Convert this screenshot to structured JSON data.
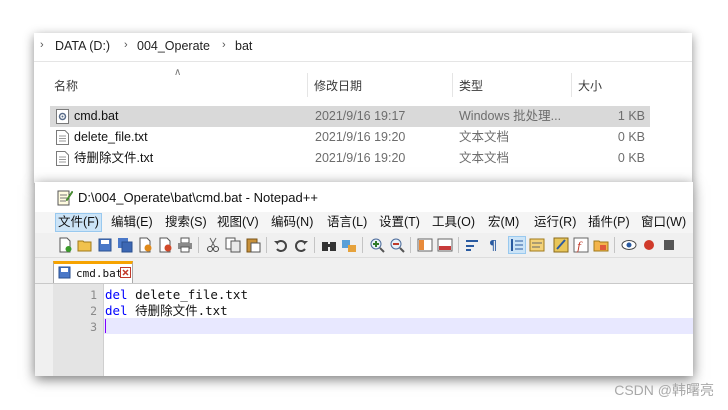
{
  "explorer": {
    "breadcrumb": [
      "DATA (D:)",
      "004_Operate",
      "bat"
    ],
    "columns": [
      "名称",
      "修改日期",
      "类型",
      "大小"
    ],
    "files": [
      {
        "name": "cmd.bat",
        "date": "2021/9/16 19:17",
        "type": "Windows 批处理...",
        "size": "1 KB",
        "icon": "batch-file-icon",
        "selected": true
      },
      {
        "name": "delete_file.txt",
        "date": "2021/9/16 19:20",
        "type": "文本文档",
        "size": "0 KB",
        "icon": "text-file-icon",
        "selected": false
      },
      {
        "name": "待删除文件.txt",
        "date": "2021/9/16 19:20",
        "type": "文本文档",
        "size": "0 KB",
        "icon": "text-file-icon",
        "selected": false
      }
    ]
  },
  "notepad": {
    "title": "D:\\004_Operate\\bat\\cmd.bat - Notepad++",
    "menus": [
      "文件(F)",
      "编辑(E)",
      "搜索(S)",
      "视图(V)",
      "编码(N)",
      "语言(L)",
      "设置(T)",
      "工具(O)",
      "宏(M)",
      "运行(R)",
      "插件(P)",
      "窗口(W)"
    ],
    "active_menu": "文件(F)",
    "tab_label": "cmd.bat",
    "line_numbers": [
      "1",
      "2",
      "3"
    ],
    "code": [
      {
        "kw": "del",
        "rest": " delete_file.txt"
      },
      {
        "kw": "del",
        "rest": " 待删除文件.txt"
      },
      {
        "kw": "",
        "rest": ""
      }
    ]
  },
  "watermark": "CSDN @韩曙亮",
  "colors": {
    "selection": "#d9d9d9",
    "keyword": "#0000ff",
    "current_line": "#e8e8ff",
    "tab_accent": "#f6a300"
  }
}
